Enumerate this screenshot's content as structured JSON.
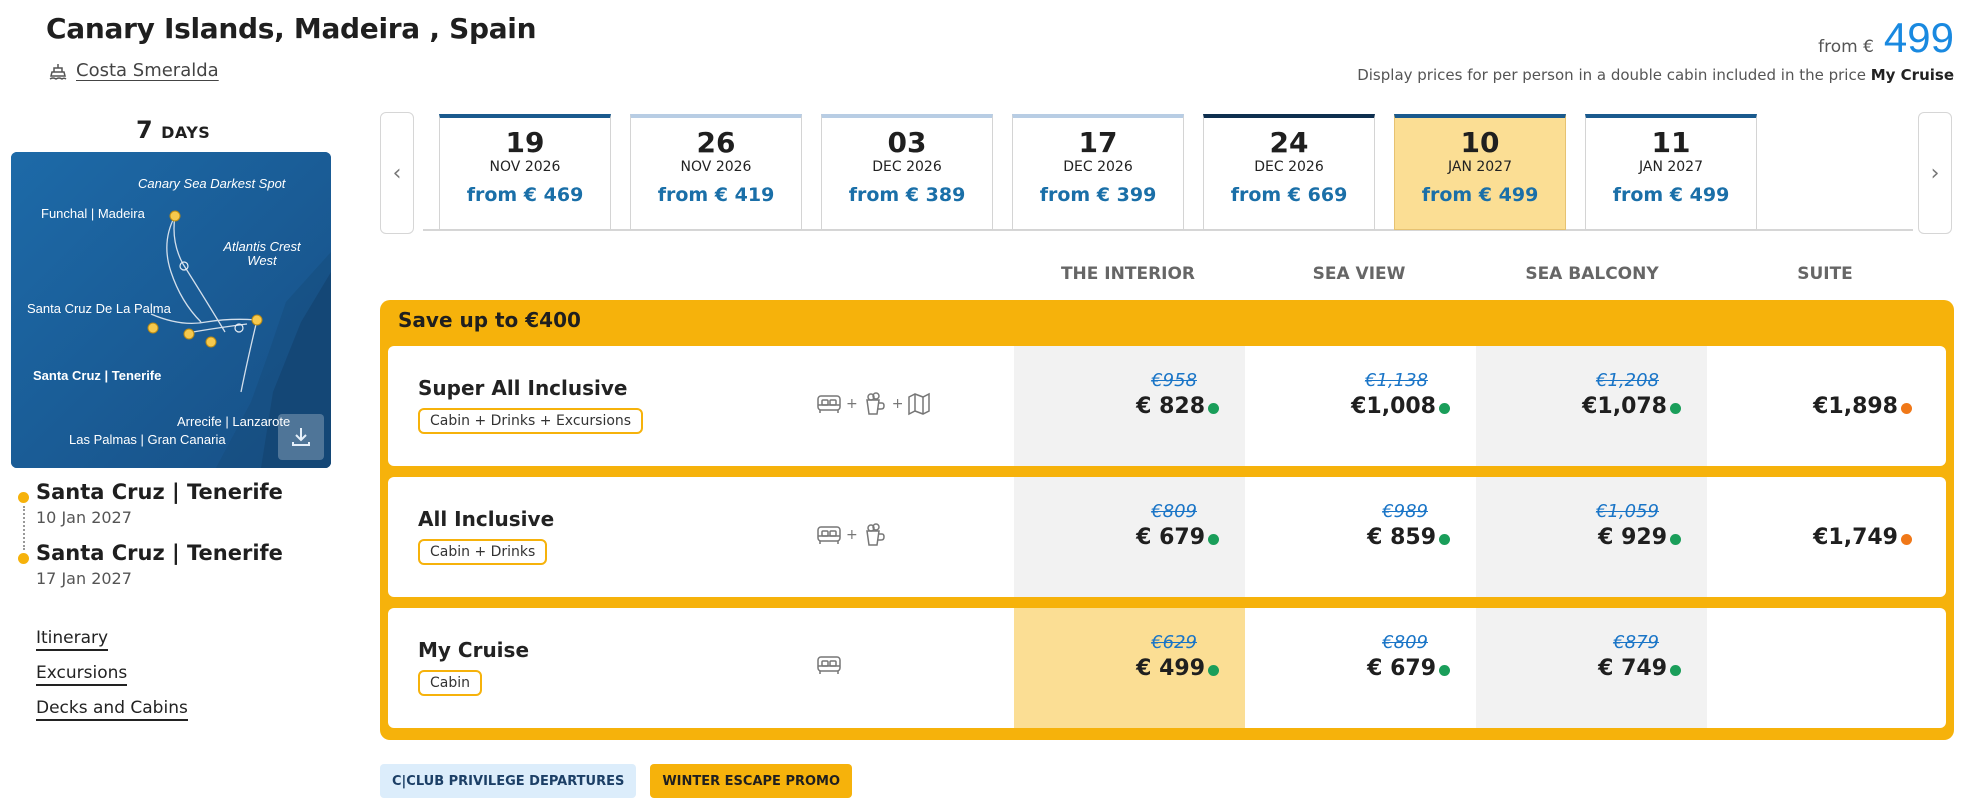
{
  "header": {
    "title": "Canary Islands, Madeira , Spain",
    "ship": "Costa Smeralda",
    "price_from_label": "from €",
    "price_from_value": "499",
    "price_note": "Display prices for per person in a double cabin included in the price",
    "price_note_bold": "My Cruise"
  },
  "duration": {
    "number": "7",
    "unit": "DAYS"
  },
  "map": {
    "labels": {
      "canary_sea": "Canary Sea Darkest Spot",
      "funchal": "Funchal | Madeira",
      "atlantis": "Atlantis Crest West",
      "santa_cruz_palma": "Santa Cruz De La Palma",
      "santa_cruz_tenerife": "Santa Cruz | Tenerife",
      "arrecife": "Arrecife | Lanzarote",
      "las_palmas": "Las Palmas | Gran Canaria"
    },
    "icon": "download-icon"
  },
  "ports": [
    {
      "name": "Santa Cruz | Tenerife",
      "date": "10 Jan 2027"
    },
    {
      "name": "Santa Cruz | Tenerife",
      "date": "17 Jan 2027"
    }
  ],
  "links": [
    "Itinerary",
    "Excursions",
    "Decks and Cabins"
  ],
  "date_nav": {
    "prev": "‹",
    "next": "›"
  },
  "dates": [
    {
      "day": "19",
      "month": "NOV 2026",
      "price": "from € 469"
    },
    {
      "day": "26",
      "month": "NOV 2026",
      "price": "from € 419"
    },
    {
      "day": "03",
      "month": "DEC 2026",
      "price": "from € 389"
    },
    {
      "day": "17",
      "month": "DEC 2026",
      "price": "from € 399"
    },
    {
      "day": "24",
      "month": "DEC 2026",
      "price": "from € 669"
    },
    {
      "day": "10",
      "month": "JAN 2027",
      "price": "from € 499"
    },
    {
      "day": "11",
      "month": "JAN 2027",
      "price": "from € 499"
    }
  ],
  "cabin_columns": [
    "THE INTERIOR",
    "SEA VIEW",
    "SEA BALCONY",
    "SUITE"
  ],
  "promo_title": "Save up to €400",
  "packages": [
    {
      "name": "Super All Inclusive",
      "tag": "Cabin + Drinks + Excursions",
      "icons": [
        "bed-icon",
        "drink-icon",
        "map-icon"
      ],
      "prices": [
        {
          "old": "€958",
          "new": "€ 828",
          "status": "green"
        },
        {
          "old": "€1,138",
          "new": "€1,008",
          "status": "green"
        },
        {
          "old": "€1,208",
          "new": "€1,078",
          "status": "green"
        },
        {
          "old": "",
          "new": "€1,898",
          "status": "orange"
        }
      ]
    },
    {
      "name": "All Inclusive",
      "tag": "Cabin + Drinks",
      "icons": [
        "bed-icon",
        "drink-icon"
      ],
      "prices": [
        {
          "old": "€809",
          "new": "€ 679",
          "status": "green"
        },
        {
          "old": "€989",
          "new": "€ 859",
          "status": "green"
        },
        {
          "old": "€1,059",
          "new": "€ 929",
          "status": "green"
        },
        {
          "old": "",
          "new": "€1,749",
          "status": "orange"
        }
      ]
    },
    {
      "name": "My Cruise",
      "tag": "Cabin",
      "icons": [
        "bed-icon"
      ],
      "prices": [
        {
          "old": "€629",
          "new": "€ 499",
          "status": "green"
        },
        {
          "old": "€809",
          "new": "€ 679",
          "status": "green"
        },
        {
          "old": "€879",
          "new": "€ 749",
          "status": "green"
        },
        {
          "old": "",
          "new": "",
          "status": ""
        }
      ]
    }
  ],
  "status_colors": {
    "green": "#1a9e5a",
    "orange": "#f07818"
  },
  "badges": [
    "C|CLUB PRIVILEGE DEPARTURES",
    "WINTER ESCAPE PROMO"
  ]
}
